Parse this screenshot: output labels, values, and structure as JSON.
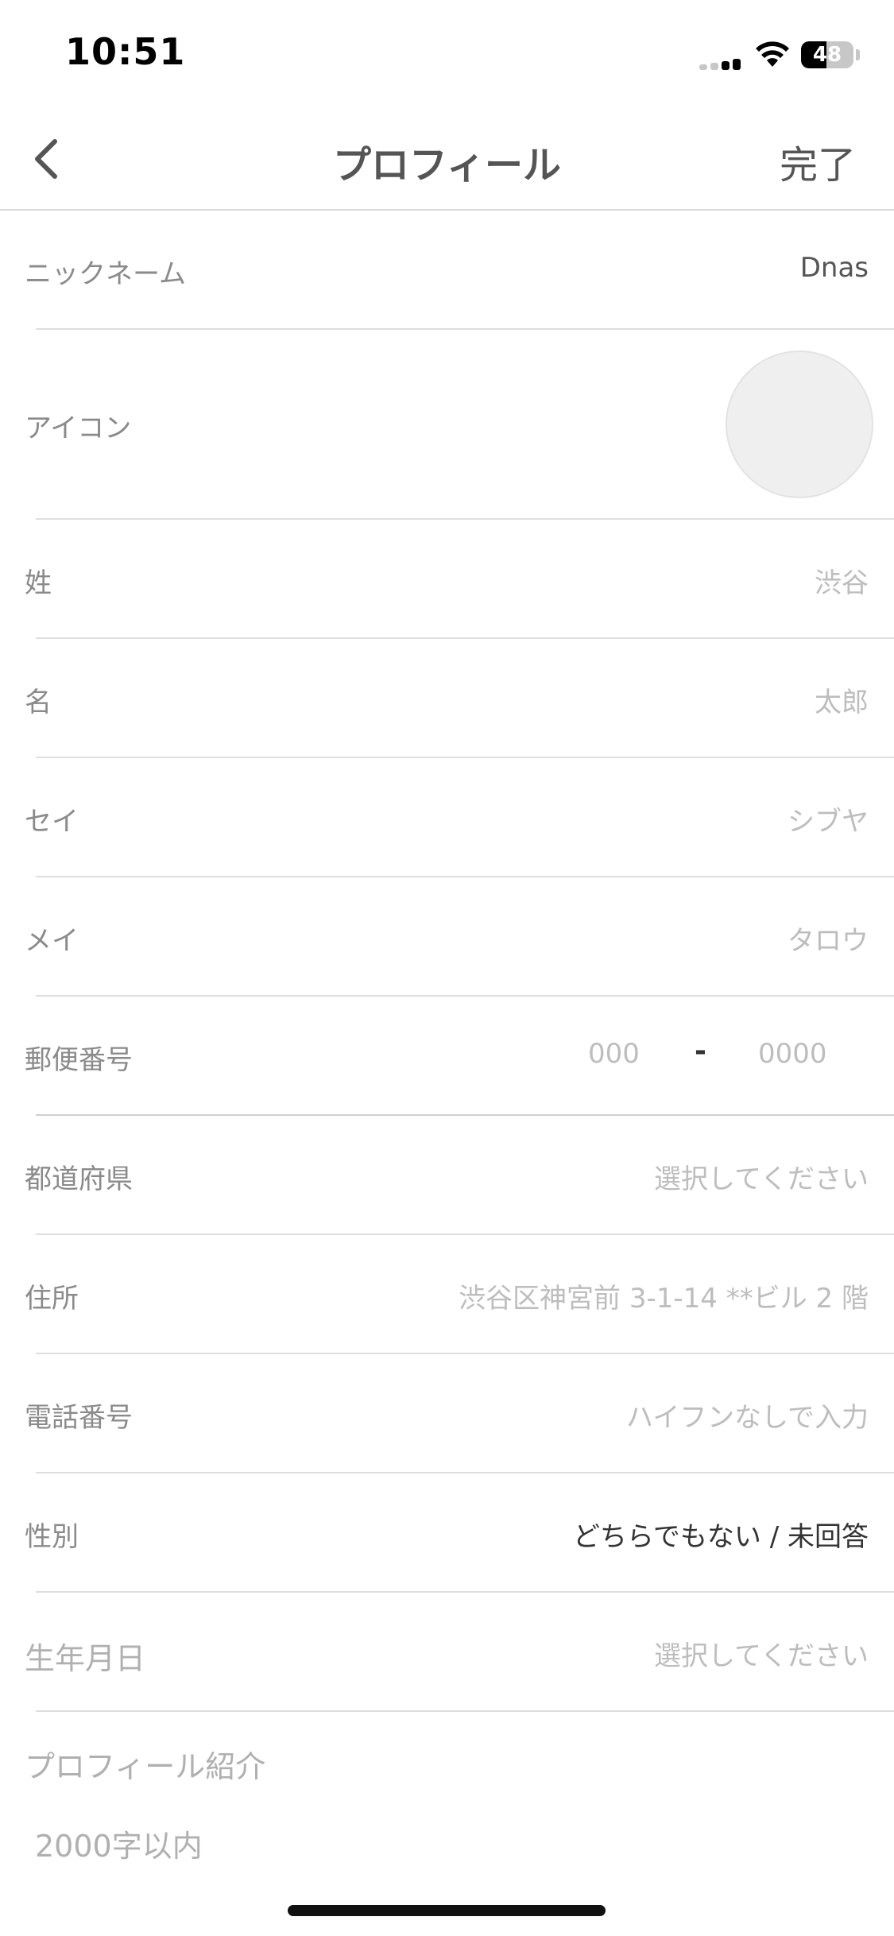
{
  "status_bar": {
    "time": "10:51",
    "battery_level": "48",
    "battery_fraction": 0.48,
    "icons": [
      "cellular-signal-icon",
      "wifi-icon",
      "battery-icon"
    ]
  },
  "nav": {
    "back_icon": "chevron-left-icon",
    "title": "プロフィール",
    "done_label": "完了"
  },
  "rows": {
    "nickname": {
      "label": "ニックネーム",
      "value": "Dnas"
    },
    "icon": {
      "label": "アイコン"
    },
    "last_name": {
      "label": "姓",
      "placeholder": "渋谷"
    },
    "first_name": {
      "label": "名",
      "placeholder": "太郎"
    },
    "last_name_kana": {
      "label": "セイ",
      "placeholder": "シブヤ"
    },
    "first_name_kana": {
      "label": "メイ",
      "placeholder": "タロウ"
    },
    "postal_code": {
      "label": "郵便番号",
      "placeholder_first": "000",
      "separator": "-",
      "placeholder_second": "0000"
    },
    "prefecture": {
      "label": "都道府県",
      "placeholder": "選択してください"
    },
    "address": {
      "label": "住所",
      "placeholder": "渋谷区神宮前 3-1-14 **ビル 2 階"
    },
    "phone": {
      "label": "電話番号",
      "placeholder": "ハイフンなしで入力"
    },
    "gender": {
      "label": "性別",
      "value": "どちらでもない / 未回答"
    },
    "birthday": {
      "label": "生年月日",
      "placeholder": "選択してください"
    }
  },
  "bio": {
    "label": "プロフィール紹介",
    "placeholder": "2000字以内"
  },
  "colors": {
    "label": "#8a8a8a",
    "placeholder": "#bdbdbd",
    "value": "#555555",
    "divider": "#dedede"
  }
}
